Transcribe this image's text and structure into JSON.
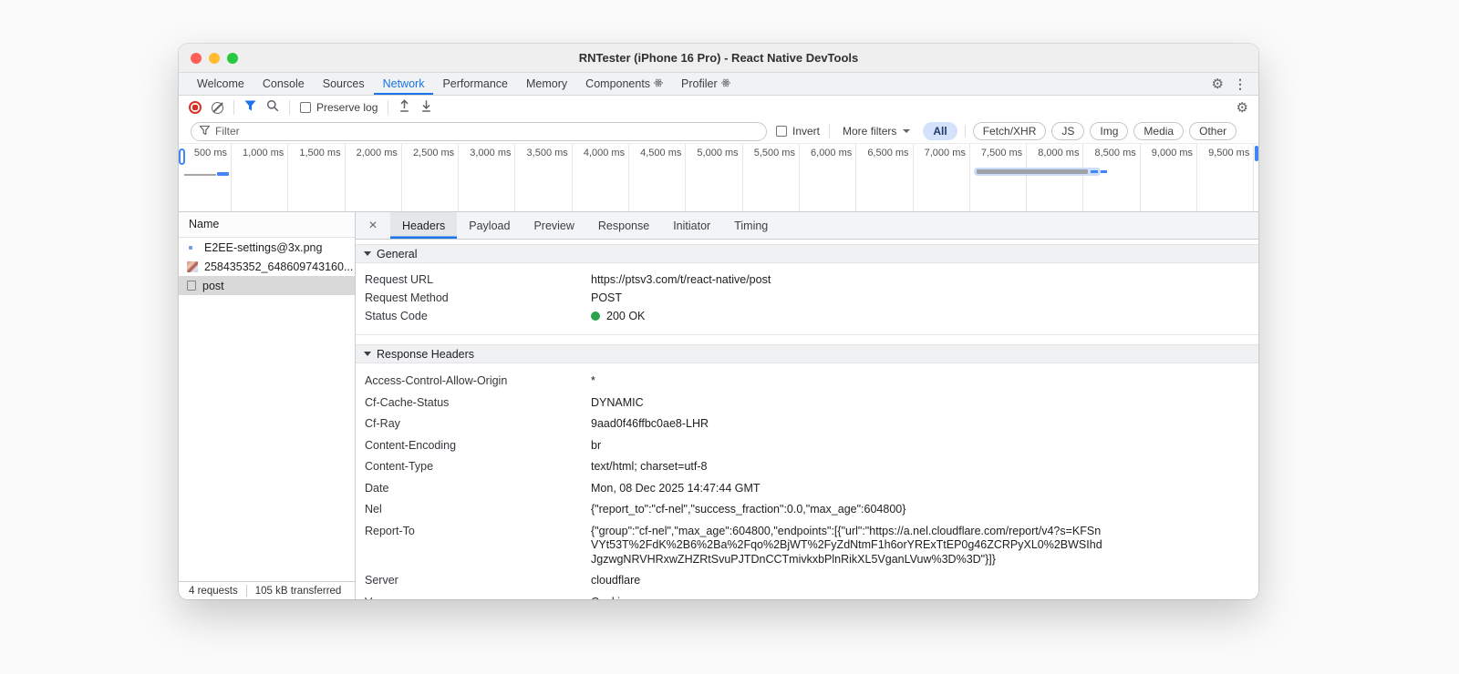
{
  "window": {
    "title": "RNTester (iPhone 16 Pro) - React Native DevTools"
  },
  "icons": {
    "settings": "⚙",
    "overflow": "⋮",
    "close": "×"
  },
  "main_tabs": {
    "items": [
      {
        "label": "Welcome",
        "active": false
      },
      {
        "label": "Console",
        "active": false
      },
      {
        "label": "Sources",
        "active": false
      },
      {
        "label": "Network",
        "active": true
      },
      {
        "label": "Performance",
        "active": false
      },
      {
        "label": "Memory",
        "active": false
      },
      {
        "label": "Components",
        "active": false,
        "badge": "react-atom"
      },
      {
        "label": "Profiler",
        "active": false,
        "badge": "react-atom"
      }
    ]
  },
  "net_toolbar": {
    "preserve_log_label": "Preserve log"
  },
  "filter_bar": {
    "placeholder": "Filter",
    "invert_label": "Invert",
    "more_filters_label": "More filters",
    "chips": [
      {
        "label": "All",
        "selected": true
      },
      {
        "label": "Fetch/XHR",
        "selected": false
      },
      {
        "label": "JS",
        "selected": false
      },
      {
        "label": "Img",
        "selected": false
      },
      {
        "label": "Media",
        "selected": false
      },
      {
        "label": "Other",
        "selected": false
      }
    ]
  },
  "timeline": {
    "ticks": [
      "500 ms",
      "1,000 ms",
      "1,500 ms",
      "2,000 ms",
      "2,500 ms",
      "3,000 ms",
      "3,500 ms",
      "4,000 ms",
      "4,500 ms",
      "5,000 ms",
      "5,500 ms",
      "6,000 ms",
      "6,500 ms",
      "7,000 ms",
      "7,500 ms",
      "8,000 ms",
      "8,500 ms",
      "9,000 ms",
      "9,500 ms"
    ]
  },
  "requests": {
    "header": "Name",
    "rows": [
      {
        "name": "E2EE-settings@3x.png",
        "icon": "image-thumbnail",
        "selected": false
      },
      {
        "name": "258435352_648609743160...",
        "icon": "image-thumbnail",
        "selected": false
      },
      {
        "name": "post",
        "icon": "document",
        "selected": true
      }
    ]
  },
  "status_bar": {
    "requests": "4 requests",
    "transferred": "105 kB transferred"
  },
  "detail_tabs": {
    "items": [
      {
        "label": "Headers",
        "active": true
      },
      {
        "label": "Payload",
        "active": false
      },
      {
        "label": "Preview",
        "active": false
      },
      {
        "label": "Response",
        "active": false
      },
      {
        "label": "Initiator",
        "active": false
      },
      {
        "label": "Timing",
        "active": false
      }
    ]
  },
  "sections": {
    "general": {
      "title": "General",
      "rows": [
        {
          "name": "Request URL",
          "value": "https://ptsv3.com/t/react-native/post"
        },
        {
          "name": "Request Method",
          "value": "POST"
        },
        {
          "name": "Status Code",
          "value": "200 OK",
          "dot_color": "#2BA24C"
        }
      ]
    },
    "response_headers": {
      "title": "Response Headers",
      "rows": [
        {
          "name": "Access-Control-Allow-Origin",
          "value": "*"
        },
        {
          "name": "Cf-Cache-Status",
          "value": "DYNAMIC"
        },
        {
          "name": "Cf-Ray",
          "value": "9aad0f46ffbc0ae8-LHR"
        },
        {
          "name": "Content-Encoding",
          "value": "br"
        },
        {
          "name": "Content-Type",
          "value": "text/html; charset=utf-8"
        },
        {
          "name": "Date",
          "value": "Mon, 08 Dec 2025 14:47:44 GMT"
        },
        {
          "name": "Nel",
          "value": "{\"report_to\":\"cf-nel\",\"success_fraction\":0.0,\"max_age\":604800}"
        },
        {
          "name": "Report-To",
          "value": "{\"group\":\"cf-nel\",\"max_age\":604800,\"endpoints\":[{\"url\":\"https://a.nel.cloudflare.com/report/v4?s=KFSnVYt53T%2FdK%2B6%2Ba%2Fqo%2BjWT%2FyZdNtmF1h6orYRExTtEP0g46ZCRPyXL0%2BWSIhdJgzwgNRVHRxwZHZRtSvuPJTDnCCTmivkxbPlnRikXL5VganLVuw%3D%3D\"}]}"
        },
        {
          "name": "Server",
          "value": "cloudflare"
        },
        {
          "name": "Vary",
          "value": "Cookie"
        }
      ]
    }
  },
  "colors": {
    "accent_blue": "#1A73E8",
    "status_green": "#2BA24C",
    "record_red": "#D93025",
    "selection_gray": "#D9D9D9"
  }
}
